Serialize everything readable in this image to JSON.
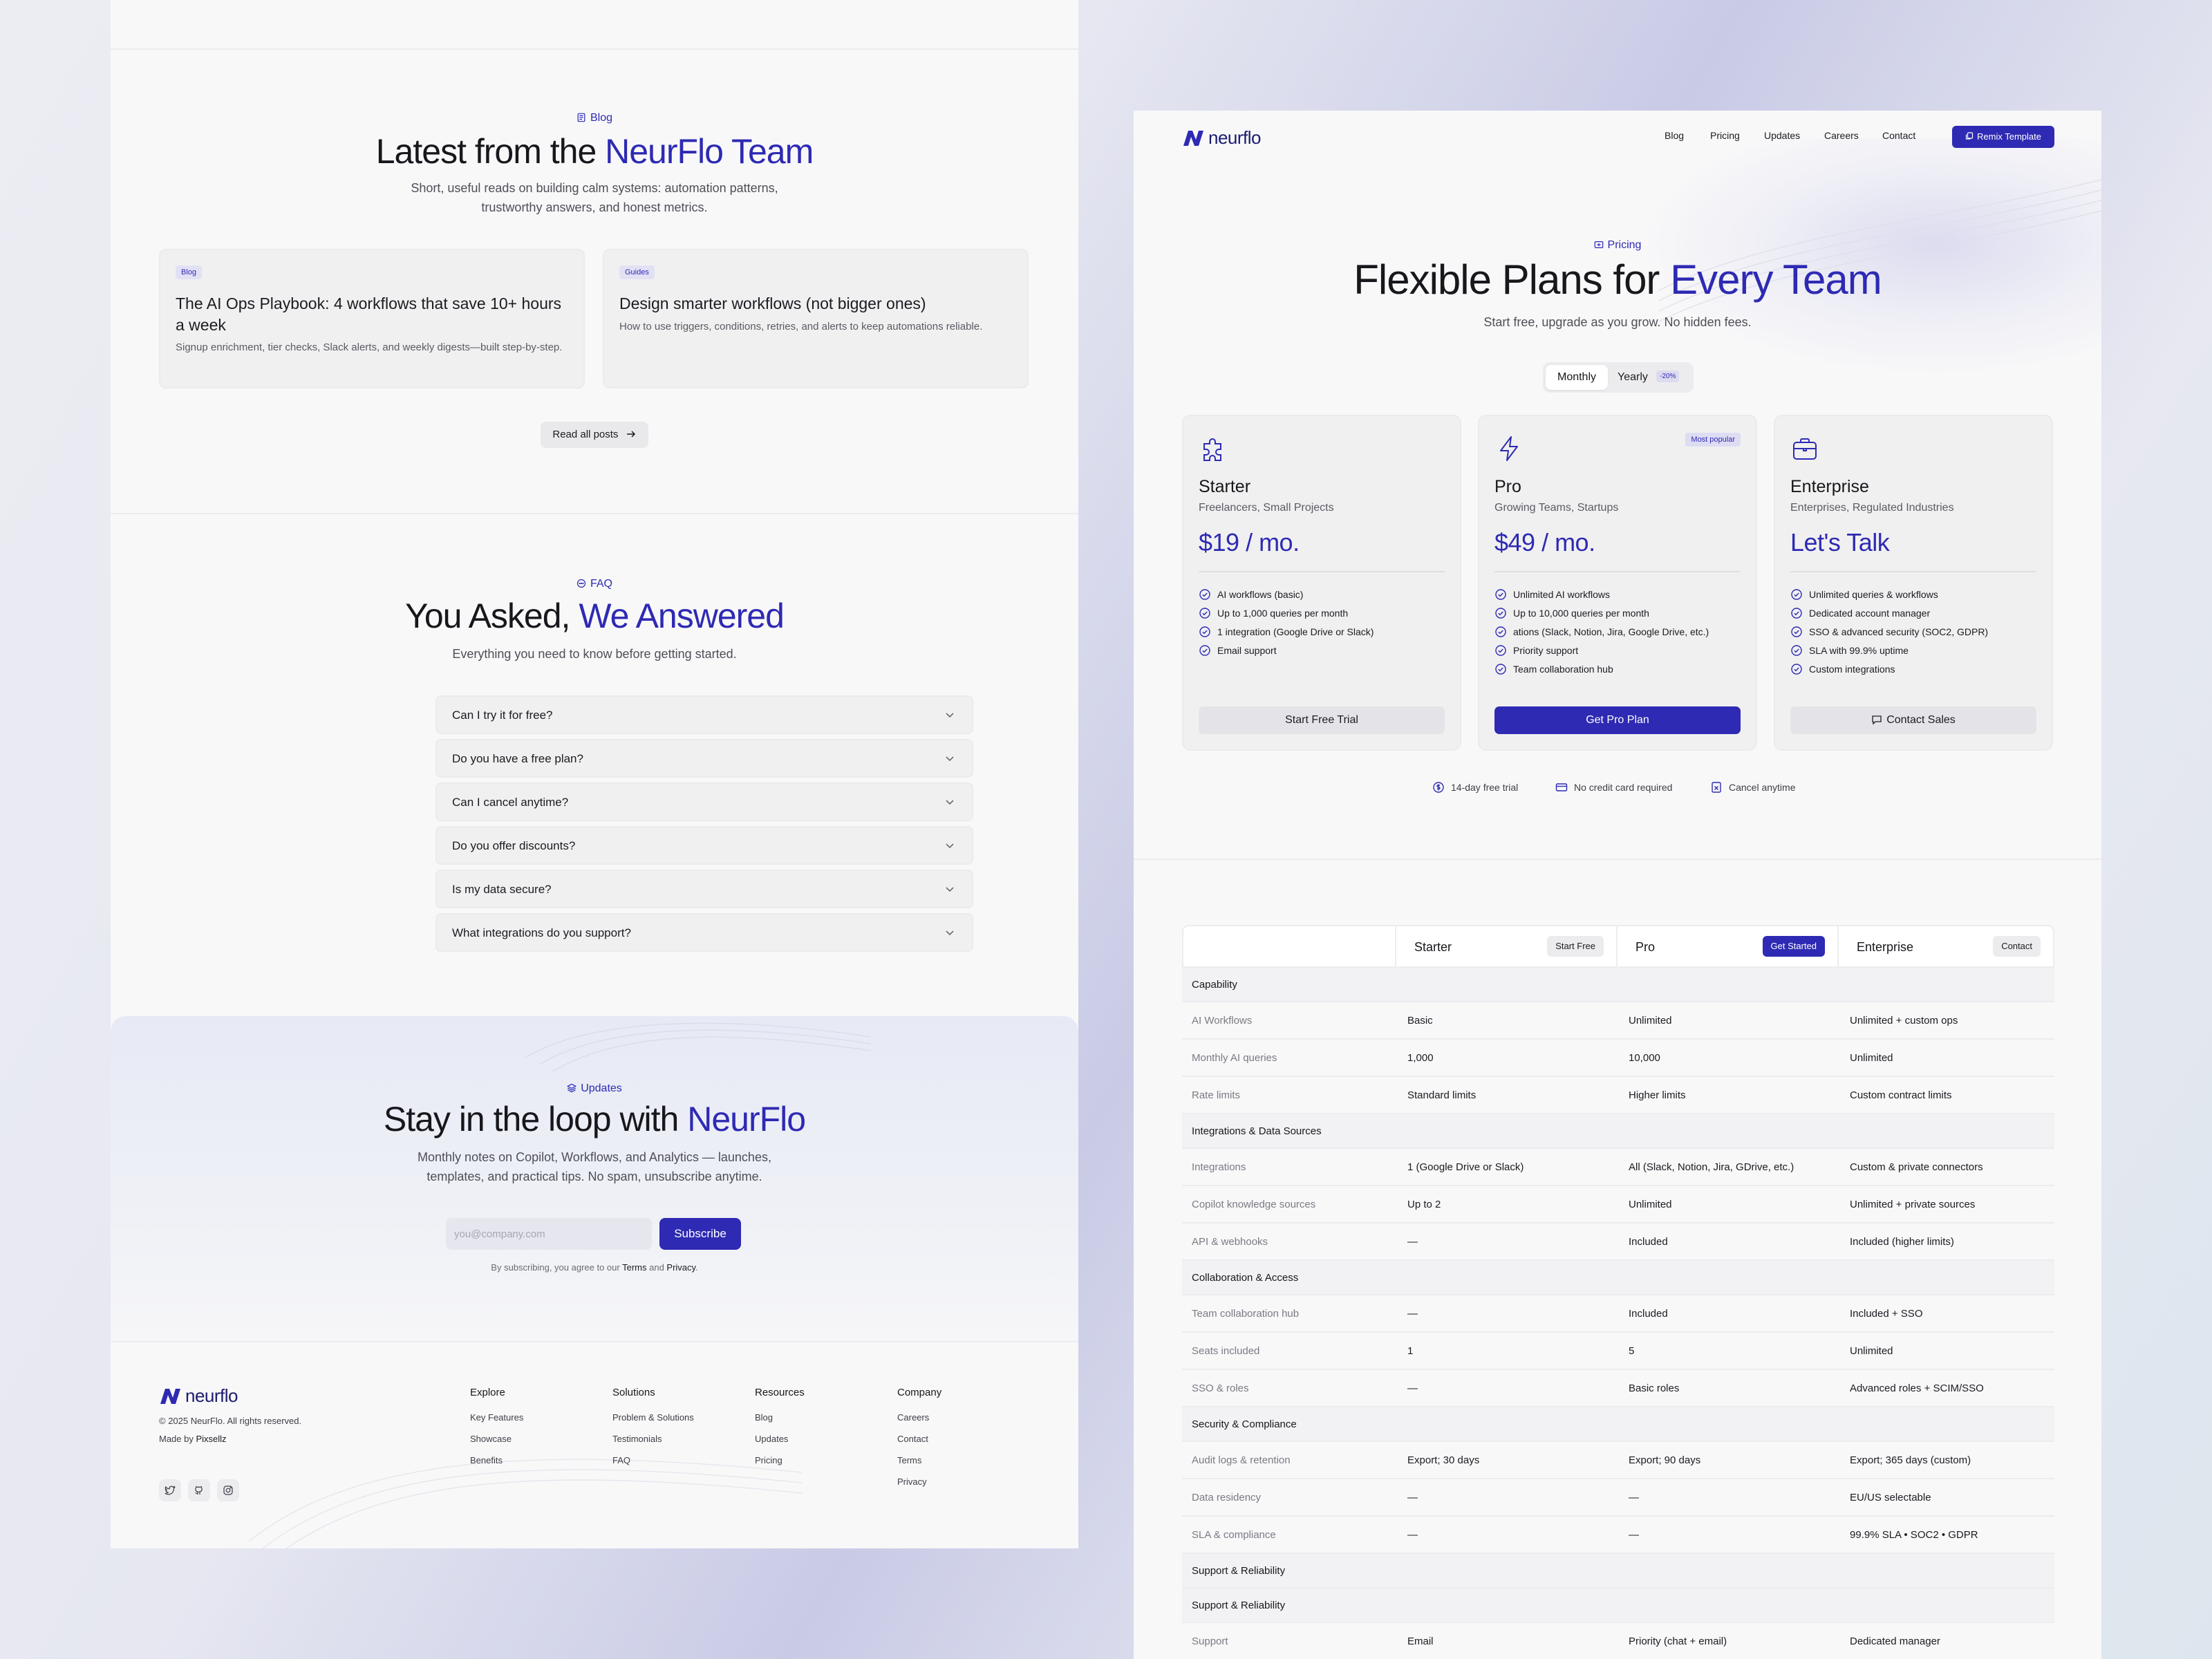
{
  "blog": {
    "tag": "Blog",
    "title_a": "Latest from the ",
    "title_b": "NeurFlo Team",
    "subtitle_1": "Short, useful reads on building calm systems: automation patterns,",
    "subtitle_2": "trustworthy answers, and honest metrics.",
    "posts": [
      {
        "chip": "Blog",
        "title": "The AI Ops Playbook: 4 workflows that save 10+ hours a week",
        "desc": "Signup enrichment, tier checks, Slack alerts, and weekly digests—built step-by-step."
      },
      {
        "chip": "Guides",
        "title": "Design smarter workflows (not bigger ones)",
        "desc": "How to use triggers, conditions, retries, and alerts to keep automations reliable."
      }
    ],
    "read_all": "Read all posts"
  },
  "faq": {
    "tag": "FAQ",
    "title_a": "You Asked, ",
    "title_b": "We Answered",
    "subtitle": "Everything you need to know before getting started.",
    "questions": [
      "Can I try it for free?",
      "Do you have a free plan?",
      "Can I cancel anytime?",
      "Do you offer discounts?",
      "Is my data secure?",
      "What integrations do you support?"
    ]
  },
  "newsletter": {
    "tag": "Updates",
    "title_a": "Stay in the loop with ",
    "title_b": "NeurFlo",
    "subtitle_1": "Monthly notes on Copilot, Workflows, and Analytics — launches,",
    "subtitle_2": "templates, and practical tips. No spam, unsubscribe anytime.",
    "email_placeholder": "you@company.com",
    "subscribe": "Subscribe",
    "legal_a": "By subscribing, you agree to our ",
    "legal_terms": "Terms",
    "legal_and": " and ",
    "legal_privacy": "Privacy",
    "legal_end": "."
  },
  "footer": {
    "brand": "neurflo",
    "copyright": "© 2025 NeurFlo. All rights reserved.",
    "made_by_a": "Made by ",
    "made_by_b": "Pixsellz",
    "columns": [
      {
        "title": "Explore",
        "links": [
          "Key Features",
          "Showcase",
          "Benefits"
        ]
      },
      {
        "title": "Solutions",
        "links": [
          "Problem & Solutions",
          "Testimonials",
          "FAQ"
        ]
      },
      {
        "title": "Resources",
        "links": [
          "Blog",
          "Updates",
          "Pricing"
        ]
      },
      {
        "title": "Company",
        "links": [
          "Careers",
          "Contact",
          "Terms",
          "Privacy"
        ]
      }
    ]
  },
  "nav": {
    "brand": "neurflo",
    "links": [
      "Blog",
      "Pricing",
      "Updates",
      "Careers",
      "Contact"
    ],
    "cta": "Remix Template"
  },
  "pricing": {
    "tag": "Pricing",
    "title_a": "Flexible Plans for ",
    "title_b": "Every Team",
    "subtitle": "Start free, upgrade as you grow. No hidden fees.",
    "toggle": {
      "monthly": "Monthly",
      "yearly": "Yearly",
      "badge": "-20%"
    },
    "plans": [
      {
        "name": "Starter",
        "audience": "Freelancers, Small Projects",
        "price": "$19 / mo.",
        "features": [
          "AI workflows (basic)",
          "Up to 1,000 queries per month",
          "1 integration (Google Drive or Slack)",
          "Email support"
        ],
        "cta": "Start Free Trial"
      },
      {
        "name": "Pro",
        "audience": "Growing Teams, Startups",
        "price": "$49 / mo.",
        "badge": "Most popular",
        "features": [
          "Unlimited AI workflows",
          "Up to 10,000 queries per month",
          "ations (Slack, Notion, Jira, Google Drive, etc.)",
          "Priority support",
          "Team collaboration hub"
        ],
        "cta": "Get Pro Plan"
      },
      {
        "name": "Enterprise",
        "audience": "Enterprises, Regulated Industries",
        "price": "Let's Talk",
        "features": [
          "Unlimited queries & workflows",
          "Dedicated account manager",
          "SSO & advanced security (SOC2, GDPR)",
          "SLA with 99.9% uptime",
          "Custom integrations"
        ],
        "cta": "Contact Sales"
      }
    ],
    "trust": [
      "14-day free trial",
      "No credit card required",
      "Cancel anytime"
    ]
  },
  "compare": {
    "columns": [
      {
        "name": "Starter",
        "cta": "Start Free"
      },
      {
        "name": "Pro",
        "cta": "Get Started"
      },
      {
        "name": "Enterprise",
        "cta": "Contact"
      }
    ],
    "rows": [
      {
        "group": "Capability"
      },
      {
        "cells": [
          "AI Workflows",
          "Basic",
          "Unlimited",
          "Unlimited + custom ops"
        ]
      },
      {
        "cells": [
          "Monthly AI queries",
          "1,000",
          "10,000",
          "Unlimited"
        ]
      },
      {
        "cells": [
          "Rate limits",
          "Standard limits",
          "Higher limits",
          "Custom contract limits"
        ]
      },
      {
        "group": "Integrations & Data Sources"
      },
      {
        "cells": [
          "Integrations",
          "1 (Google Drive or Slack)",
          "All (Slack, Notion, Jira, GDrive, etc.)",
          "Custom & private connectors"
        ]
      },
      {
        "cells": [
          "Copilot knowledge sources",
          "Up to 2",
          "Unlimited",
          "Unlimited + private sources"
        ]
      },
      {
        "cells": [
          "API & webhooks",
          "—",
          "Included",
          "Included (higher limits)"
        ]
      },
      {
        "group": "Collaboration & Access"
      },
      {
        "cells": [
          "Team collaboration hub",
          "—",
          "Included",
          "Included + SSO"
        ]
      },
      {
        "cells": [
          "Seats included",
          "1",
          "5",
          "Unlimited"
        ]
      },
      {
        "cells": [
          "SSO & roles",
          "—",
          "Basic roles",
          "Advanced roles + SCIM/SSO"
        ]
      },
      {
        "group": "Security & Compliance"
      },
      {
        "cells": [
          "Audit logs & retention",
          "Export; 30 days",
          "Export; 90 days",
          "Export; 365 days (custom)"
        ]
      },
      {
        "cells": [
          "Data residency",
          "—",
          "—",
          "EU/US selectable"
        ]
      },
      {
        "cells": [
          "SLA & compliance",
          "—",
          "—",
          "99.9% SLA • SOC2 • GDPR"
        ]
      },
      {
        "group": "Support & Reliability"
      },
      {
        "group": "Support & Reliability"
      },
      {
        "cells": [
          "Support",
          "Email",
          "Priority (chat + email)",
          "Dedicated manager"
        ]
      }
    ]
  },
  "colors": {
    "accent": "#2e2ab3",
    "panel_bg": "#f8f8f9",
    "card_bg": "#f0f0f1",
    "muted_text": "#5a5a63"
  },
  "icons": [
    "blog-icon",
    "faq-icon",
    "updates-icon",
    "chevron-down-icon",
    "arrow-right-icon",
    "twitter-icon",
    "github-icon",
    "instagram-icon",
    "puzzle-icon",
    "lightning-icon",
    "briefcase-icon",
    "check-circle-icon",
    "chat-icon",
    "dollar-icon",
    "credit-card-icon",
    "cancel-icon"
  ]
}
